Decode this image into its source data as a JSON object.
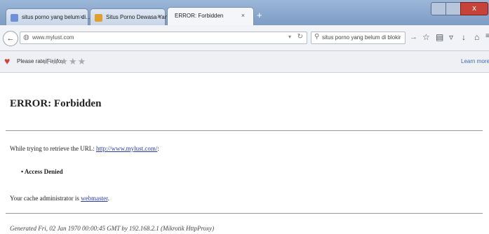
{
  "tabs": [
    {
      "label": "situs porno yang belum di...",
      "favicon_color": "#6f8fd6"
    },
    {
      "label": "Situs Porno Dewasa Yang B...",
      "favicon_color": "#e0a030"
    },
    {
      "label": "ERROR: Forbidden",
      "favicon_color": ""
    }
  ],
  "tab_close": "×",
  "new_tab": "+",
  "window": {
    "close": "x"
  },
  "nav": {
    "back": "←",
    "url": "www.mylust.com",
    "search_value": "situs porno yang belum di blokir",
    "go": "→",
    "icons": [
      "star-icon",
      "clipboard-icon",
      "pocket-icon",
      "download-icon",
      "home-icon",
      "extension-icon",
      "menu-icon"
    ]
  },
  "notification": {
    "text": "Please rate Firefox:",
    "stars": "★★★★★",
    "learn_more": "Learn more"
  },
  "page": {
    "heading": "ERROR: Forbidden",
    "line1_prefix": "While trying to retrieve the URL: ",
    "line1_link": "http://www.mylust.com/",
    "line1_suffix": ":",
    "bullet": "Access Denied",
    "line3_prefix": "Your cache administrator is ",
    "line3_link": "webmaster",
    "line3_suffix": ".",
    "footer": "Generated Fri, 02 Jan 1970 00:00:45 GMT by 192.168.2.1 (Mikrotik HttpProxy)"
  }
}
